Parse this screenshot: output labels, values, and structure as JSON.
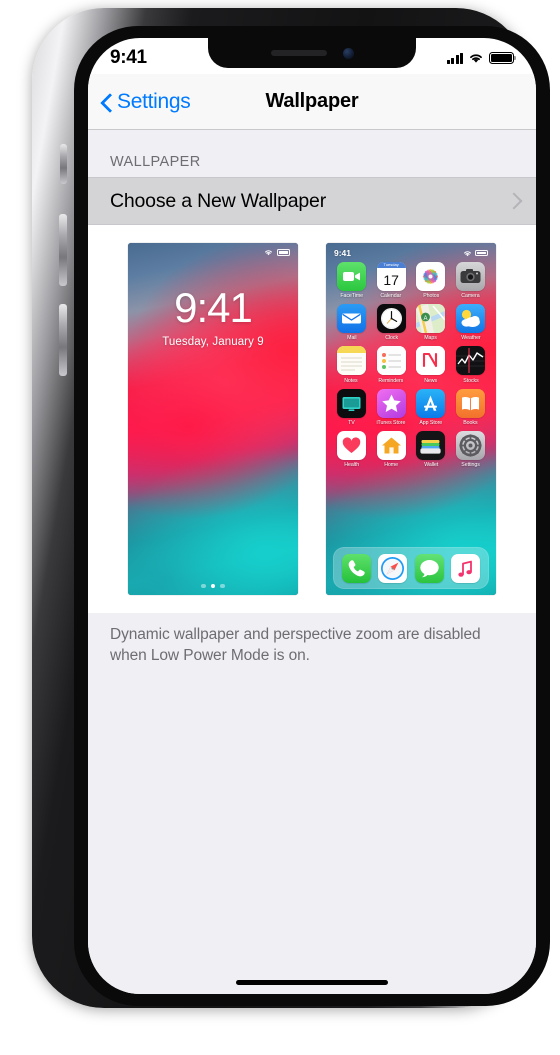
{
  "status_bar": {
    "time": "9:41",
    "signal_icon": "cellular-signal-icon",
    "wifi_icon": "wifi-icon",
    "battery_icon": "battery-full-icon"
  },
  "nav": {
    "back_label": "Settings",
    "back_icon": "chevron-left-icon",
    "title": "Wallpaper"
  },
  "section": {
    "header": "WALLPAPER",
    "choose_label": "Choose a New Wallpaper",
    "disclosure_icon": "chevron-right-icon"
  },
  "lock_preview": {
    "name": "lock-screen-preview",
    "time": "9:41",
    "date": "Tuesday, January 9",
    "wifi_icon": "wifi-icon",
    "battery_icon": "battery-icon",
    "page_dots": 3,
    "active_dot": 1
  },
  "home_preview": {
    "name": "home-screen-preview",
    "time": "9:41",
    "wifi_icon": "wifi-icon",
    "battery_icon": "battery-icon",
    "apps": [
      {
        "label": "FaceTime",
        "icon": "facetime-icon"
      },
      {
        "label": "Calendar",
        "icon": "calendar-icon",
        "day": "17",
        "weekday": "Tuesday"
      },
      {
        "label": "Photos",
        "icon": "photos-icon"
      },
      {
        "label": "Camera",
        "icon": "camera-icon"
      },
      {
        "label": "Mail",
        "icon": "mail-icon"
      },
      {
        "label": "Clock",
        "icon": "clock-icon"
      },
      {
        "label": "Maps",
        "icon": "maps-icon"
      },
      {
        "label": "Weather",
        "icon": "weather-icon"
      },
      {
        "label": "Notes",
        "icon": "notes-icon"
      },
      {
        "label": "Reminders",
        "icon": "reminders-icon"
      },
      {
        "label": "News",
        "icon": "news-icon"
      },
      {
        "label": "Stocks",
        "icon": "stocks-icon"
      },
      {
        "label": "TV",
        "icon": "tv-icon"
      },
      {
        "label": "iTunes Store",
        "icon": "itunes-store-icon"
      },
      {
        "label": "App Store",
        "icon": "app-store-icon"
      },
      {
        "label": "Books",
        "icon": "books-icon"
      },
      {
        "label": "Health",
        "icon": "health-icon"
      },
      {
        "label": "Home",
        "icon": "home-icon"
      },
      {
        "label": "Wallet",
        "icon": "wallet-icon"
      },
      {
        "label": "Settings",
        "icon": "settings-icon"
      }
    ],
    "dock": [
      {
        "label": "Phone",
        "icon": "phone-icon"
      },
      {
        "label": "Safari",
        "icon": "safari-icon"
      },
      {
        "label": "Messages",
        "icon": "messages-icon"
      },
      {
        "label": "Music",
        "icon": "music-icon"
      }
    ]
  },
  "footer": {
    "note": "Dynamic wallpaper and perspective zoom are disabled when Low Power Mode is on."
  },
  "colors": {
    "accent_blue": "#007AFF",
    "group_background": "#EFEFF4",
    "nav_background": "#F8F8F8",
    "row_pressed": "#D4D4D6",
    "secondary_text": "#6D6D72"
  }
}
